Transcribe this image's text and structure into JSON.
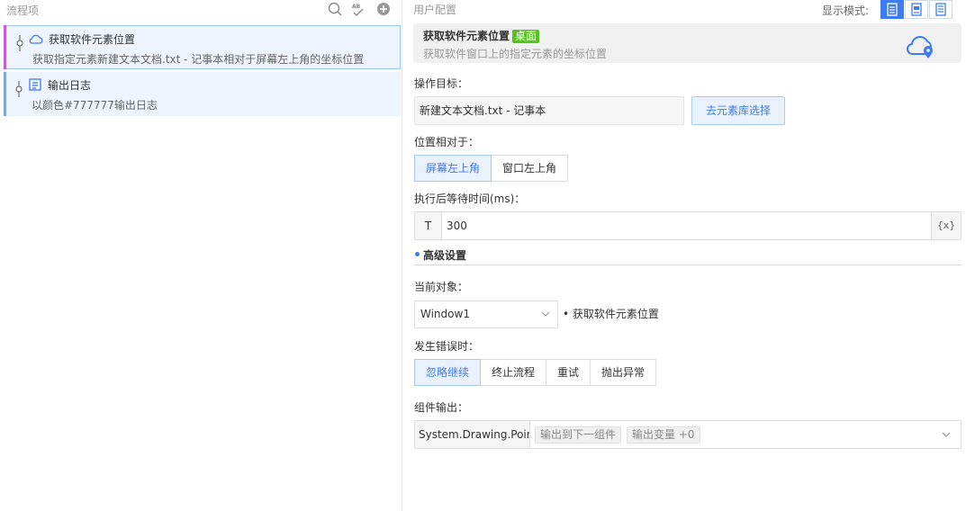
{
  "left": {
    "title": "流程项",
    "items": [
      {
        "title": "获取软件元素位置",
        "desc": "获取指定元素新建文本文档.txt - 记事本相对于屏幕左上角的坐标位置",
        "icon": "cloud-icon"
      },
      {
        "title": "输出日志",
        "desc": "以颜色#777777输出日志",
        "icon": "log-icon"
      }
    ]
  },
  "right": {
    "title": "用户配置",
    "mode_label": "显示模式:",
    "card": {
      "title": "获取软件元素位置",
      "badge": "桌面",
      "desc": "获取软件窗口上的指定元素的坐标位置"
    },
    "target": {
      "label": "操作目标：",
      "value": "新建文本文档.txt - 记事本",
      "pick_button": "去元素库选择"
    },
    "relative": {
      "label": "位置相对于：",
      "options": [
        "屏幕左上角",
        "窗口左上角"
      ],
      "selected": "屏幕左上角"
    },
    "wait": {
      "label": "执行后等待时间(ms)：",
      "prefix": "T",
      "value": "300",
      "var_button": "{x}"
    },
    "advanced": {
      "title": "高级设置"
    },
    "current_object": {
      "label": "当前对象：",
      "value": "Window1",
      "note": "• 获取软件元素位置"
    },
    "on_error": {
      "label": "发生错误时：",
      "options": [
        "忽略继续",
        "终止流程",
        "重试",
        "抛出异常"
      ],
      "selected": "忽略继续"
    },
    "output": {
      "label": "组件输出：",
      "type": "System.Drawing.Point",
      "tags": [
        "输出到下一组件",
        "输出变量 +0"
      ]
    }
  },
  "colors": {
    "accent": "#3c7cf0",
    "badge_green": "#52c41a",
    "selected_border": "#c45cd8"
  }
}
